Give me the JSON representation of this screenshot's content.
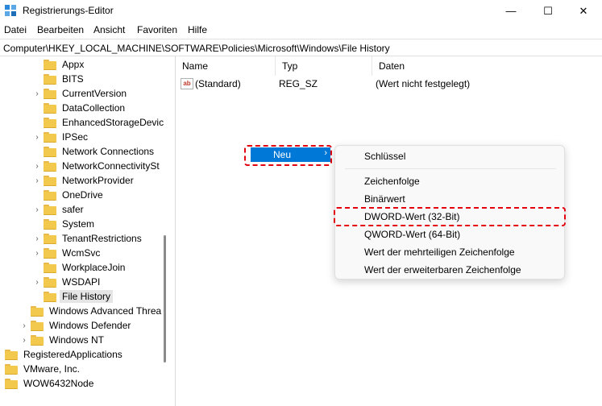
{
  "window": {
    "title": "Registrierungs-Editor",
    "controls": {
      "minimize": "—",
      "maximize": "☐",
      "close": "✕"
    }
  },
  "menu": [
    "Datei",
    "Bearbeiten",
    "Ansicht",
    "Favoriten",
    "Hilfe"
  ],
  "address": "Computer\\HKEY_LOCAL_MACHINE\\SOFTWARE\\Policies\\Microsoft\\Windows\\File History",
  "tree": {
    "items": [
      {
        "label": "Appx",
        "expandable": false,
        "level": 2
      },
      {
        "label": "BITS",
        "expandable": false,
        "level": 2
      },
      {
        "label": "CurrentVersion",
        "expandable": true,
        "level": 2
      },
      {
        "label": "DataCollection",
        "expandable": false,
        "level": 2
      },
      {
        "label": "EnhancedStorageDevic",
        "expandable": false,
        "level": 2
      },
      {
        "label": "IPSec",
        "expandable": true,
        "level": 2
      },
      {
        "label": "Network Connections",
        "expandable": false,
        "level": 2
      },
      {
        "label": "NetworkConnectivitySt",
        "expandable": true,
        "level": 2
      },
      {
        "label": "NetworkProvider",
        "expandable": true,
        "level": 2
      },
      {
        "label": "OneDrive",
        "expandable": false,
        "level": 2
      },
      {
        "label": "safer",
        "expandable": true,
        "level": 2
      },
      {
        "label": "System",
        "expandable": false,
        "level": 2
      },
      {
        "label": "TenantRestrictions",
        "expandable": true,
        "level": 2
      },
      {
        "label": "WcmSvc",
        "expandable": true,
        "level": 2
      },
      {
        "label": "WorkplaceJoin",
        "expandable": false,
        "level": 2
      },
      {
        "label": "WSDAPI",
        "expandable": true,
        "level": 2
      },
      {
        "label": "File History",
        "expandable": false,
        "level": 2,
        "selected": true
      },
      {
        "label": "Windows Advanced Threa",
        "expandable": false,
        "level": 1
      },
      {
        "label": "Windows Defender",
        "expandable": true,
        "level": 1
      },
      {
        "label": "Windows NT",
        "expandable": true,
        "level": 1
      },
      {
        "label": "RegisteredApplications",
        "expandable": false,
        "level": 0
      },
      {
        "label": "VMware, Inc.",
        "expandable": true,
        "level": 0
      },
      {
        "label": "WOW6432Node",
        "expandable": true,
        "level": 0
      }
    ]
  },
  "columns": {
    "name": "Name",
    "type": "Typ",
    "data": "Daten"
  },
  "values": [
    {
      "name": "(Standard)",
      "type": "REG_SZ",
      "data": "(Wert nicht festgelegt)"
    }
  ],
  "context_menu": {
    "item": "Neu",
    "arrow": "›",
    "submenu": [
      "Schlüssel",
      "Zeichenfolge",
      "Binärwert",
      "DWORD-Wert (32-Bit)",
      "QWORD-Wert (64-Bit)",
      "Wert der mehrteiligen Zeichenfolge",
      "Wert der erweiterbaren Zeichenfolge"
    ]
  },
  "colors": {
    "menu_highlight": "#0078d7",
    "annotation": "#e3000f",
    "folder": "#f3c94d"
  }
}
